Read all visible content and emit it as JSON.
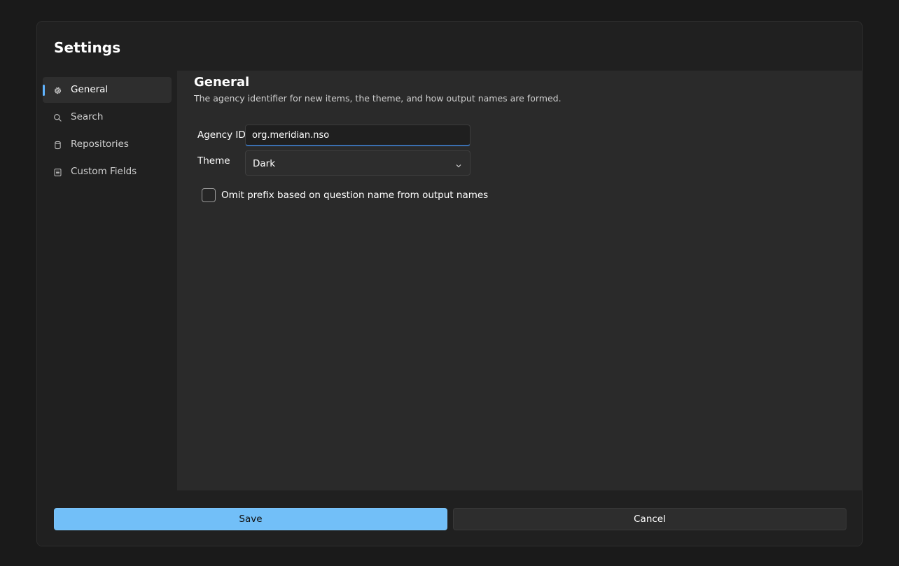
{
  "dialog": {
    "title": "Settings"
  },
  "sidebar": {
    "items": [
      {
        "label": "General",
        "icon": "gear-icon",
        "active": true
      },
      {
        "label": "Search",
        "icon": "search-icon",
        "active": false
      },
      {
        "label": "Repositories",
        "icon": "database-icon",
        "active": false
      },
      {
        "label": "Custom Fields",
        "icon": "list-icon",
        "active": false
      }
    ]
  },
  "main": {
    "title": "General",
    "description": "The agency identifier for new items, the theme, and how output names are formed.",
    "agency_id": {
      "label": "Agency ID",
      "value": "org.meridian.nso"
    },
    "theme": {
      "label": "Theme",
      "value": "Dark"
    },
    "omit_prefix": {
      "label": "Omit prefix based on question name from output names",
      "checked": false
    }
  },
  "footer": {
    "save_label": "Save",
    "cancel_label": "Cancel"
  },
  "colors": {
    "accent": "#72bff8",
    "indicator": "#60b4ff",
    "background": "#202020",
    "content": "#2a2a2a"
  }
}
